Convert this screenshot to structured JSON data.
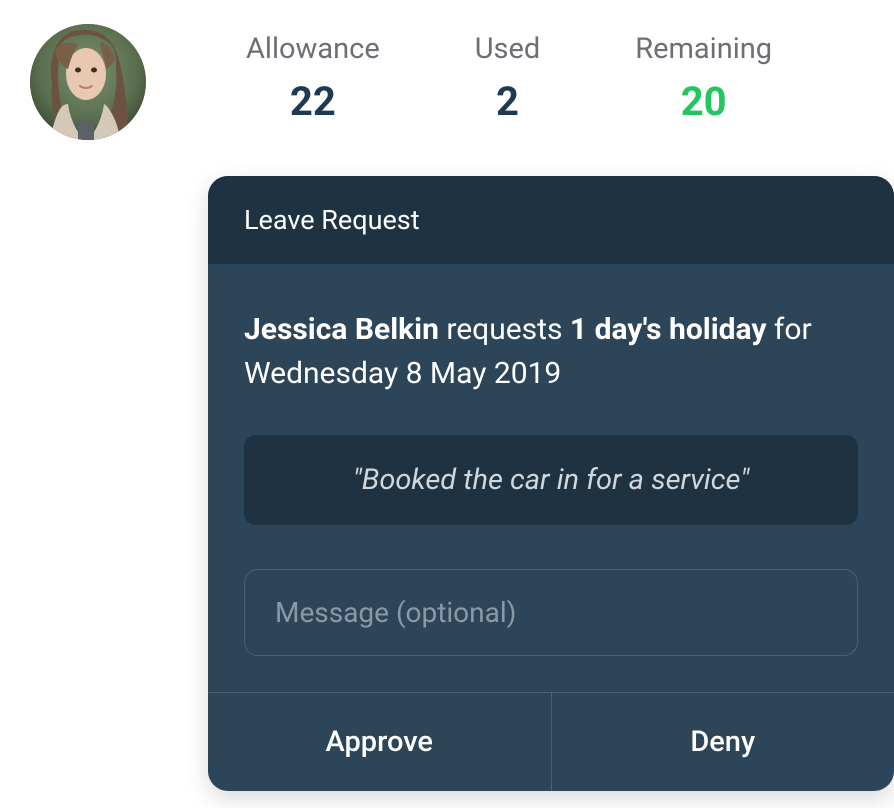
{
  "stats": {
    "allowance": {
      "label": "Allowance",
      "value": "22"
    },
    "used": {
      "label": "Used",
      "value": "2"
    },
    "remaining": {
      "label": "Remaining",
      "value": "20"
    }
  },
  "card": {
    "title": "Leave Request",
    "request": {
      "requester": "Jessica Belkin",
      "verb": " requests ",
      "duration": "1 day's holiday",
      "for_text": " for Wednesday 8 May 2019"
    },
    "quote": "\"Booked the car in for a service\"",
    "message_placeholder": "Message (optional)",
    "actions": {
      "approve": "Approve",
      "deny": "Deny"
    }
  }
}
